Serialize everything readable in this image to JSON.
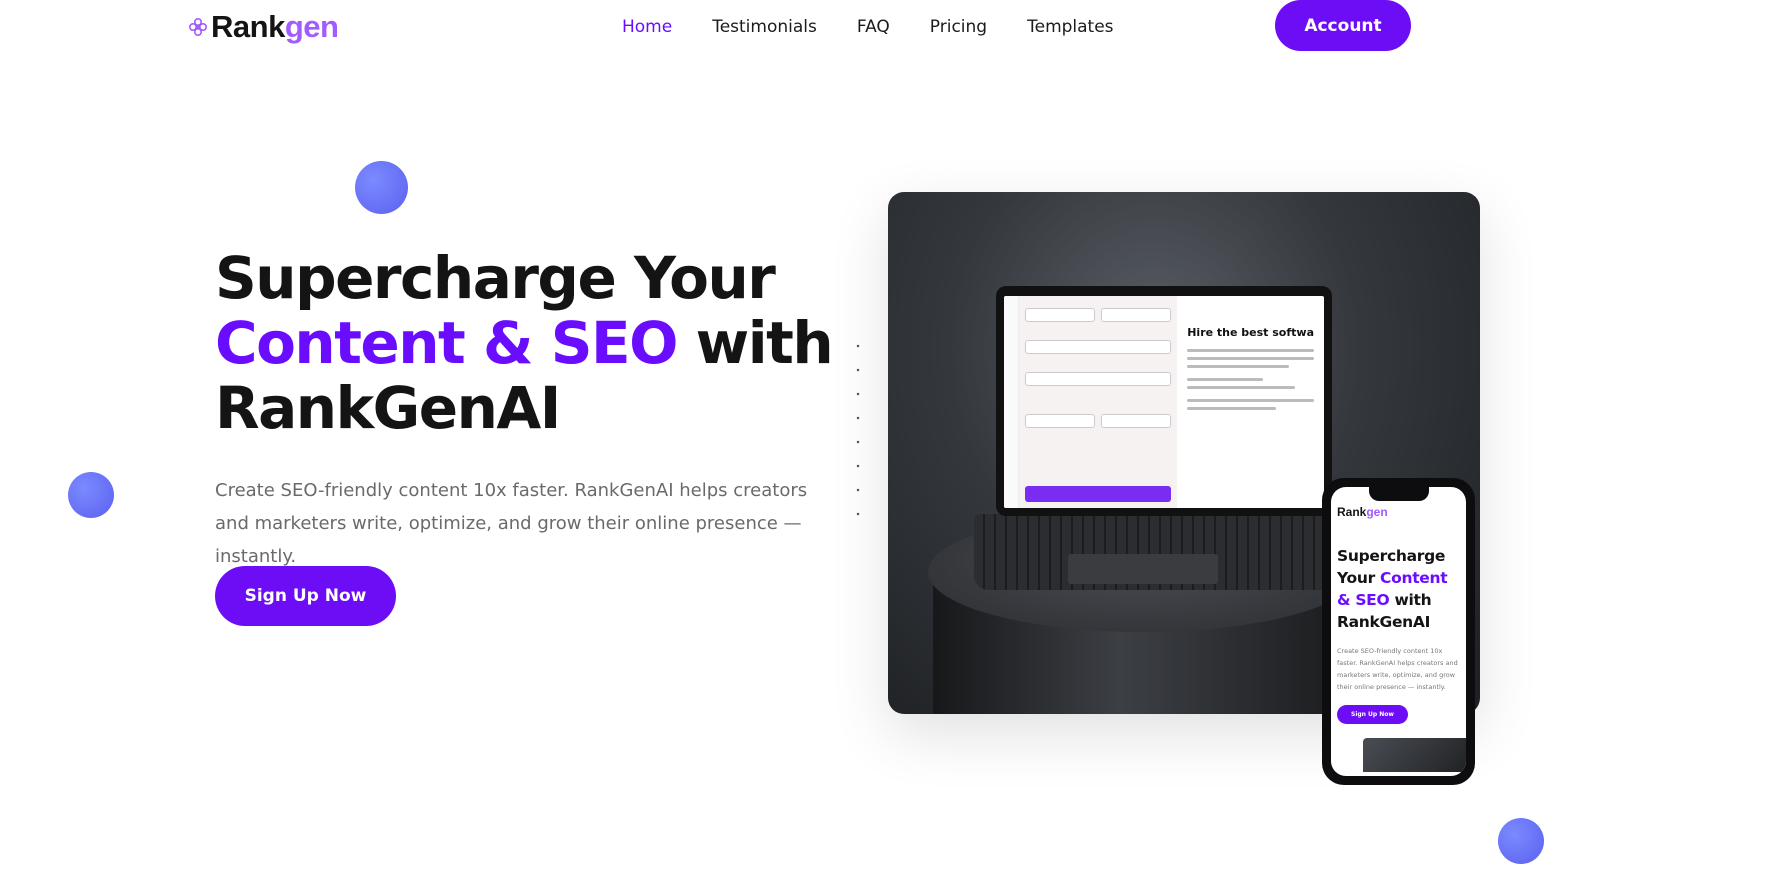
{
  "header": {
    "logo": {
      "prefix": "Rank",
      "accent": "gen"
    },
    "nav": [
      {
        "label": "Home",
        "active": true
      },
      {
        "label": "Testimonials",
        "active": false
      },
      {
        "label": "FAQ",
        "active": false
      },
      {
        "label": "Pricing",
        "active": false
      },
      {
        "label": "Templates",
        "active": false
      }
    ],
    "account_label": "Account"
  },
  "hero": {
    "title_line1": "Supercharge Your",
    "title_accent": "Content & SEO",
    "title_mid": " with",
    "title_line3": "RankGenAI",
    "subtitle": "Create SEO-friendly content 10x faster. RankGenAI helps creators and marketers write, optimize, and grow their online presence — instantly.",
    "cta_label": "Sign Up Now"
  },
  "mockup": {
    "laptop_doc_title": "Hire the best softwa",
    "phone": {
      "logo_prefix": "Rank",
      "logo_accent": "gen",
      "title_line1": "Supercharge",
      "title_line2": "Your ",
      "title_accent": "Content & SEO",
      "title_mid": " with",
      "title_line4": "RankGenAI",
      "subtitle": "Create SEO-friendly content 10x faster. RankGenAI helps creators and marketers write, optimize, and grow their online presence — instantly.",
      "cta_label": "Sign Up Now"
    }
  },
  "colors": {
    "brand_purple": "#6d0df6",
    "accent_text": "#6a0dff",
    "logo_accent": "#a15cff",
    "decor_dot": "#5b5ff0"
  }
}
